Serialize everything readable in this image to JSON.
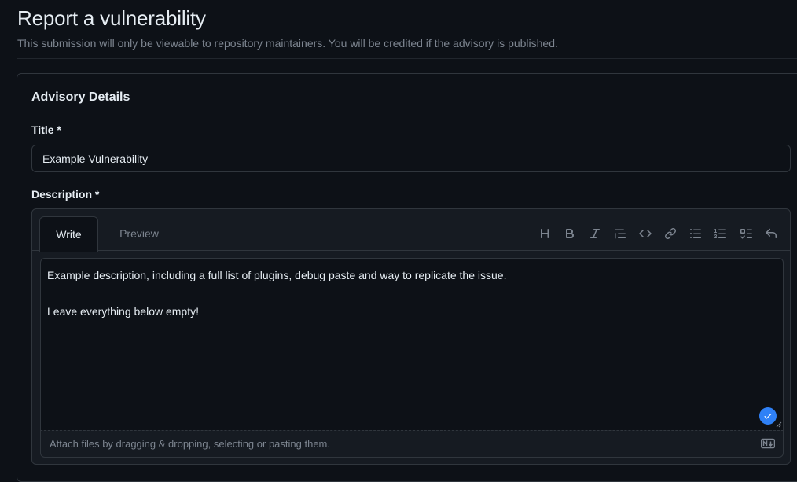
{
  "page": {
    "title": "Report a vulnerability",
    "subtitle": "This submission will only be viewable to repository maintainers. You will be credited if the advisory is published."
  },
  "advisory": {
    "section_title": "Advisory Details",
    "title_label": "Title *",
    "title_value": "Example Vulnerability",
    "description_label": "Description *"
  },
  "editor": {
    "tabs": [
      "Write",
      "Preview"
    ],
    "active_tab": "Write",
    "toolbar_icons": [
      "heading-icon",
      "bold-icon",
      "italic-icon",
      "quote-icon",
      "code-icon",
      "link-icon",
      "unordered-list-icon",
      "ordered-list-icon",
      "task-list-icon",
      "undo-icon"
    ],
    "content": "Example description, including a full list of plugins, debug paste and way to replicate the issue.\n\nLeave everything below empty!",
    "attach_hint": "Attach files by dragging & dropping, selecting or pasting them."
  },
  "colors": {
    "background": "#0d1117",
    "panel": "#161b22",
    "border": "#30363d",
    "text": "#e6edf3",
    "muted": "#7d8590",
    "accent": "#2f81f7"
  }
}
